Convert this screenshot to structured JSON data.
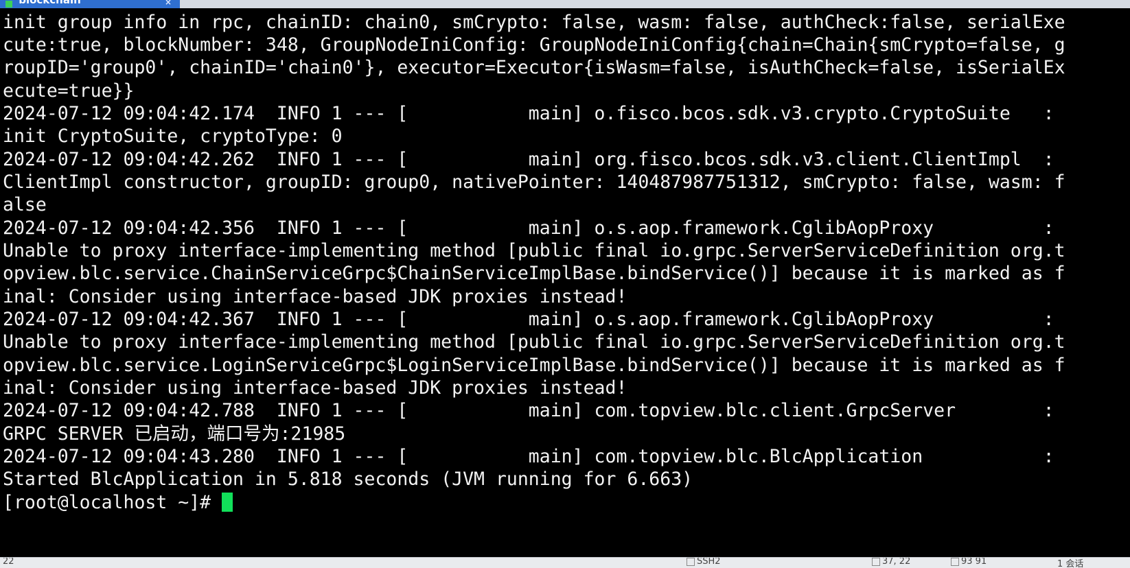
{
  "window": {
    "tab_title": "blockchain",
    "tab_close": "×"
  },
  "terminal": {
    "lines": [
      "init group info in rpc, chainID: chain0, smCrypto: false, wasm: false, authCheck:false, serialExe",
      "cute:true, blockNumber: 348, GroupNodeIniConfig: GroupNodeIniConfig{chain=Chain{smCrypto=false, g",
      "roupID='group0', chainID='chain0'}, executor=Executor{isWasm=false, isAuthCheck=false, isSerialEx",
      "ecute=true}}",
      "2024-07-12 09:04:42.174  INFO 1 --- [           main] o.fisco.bcos.sdk.v3.crypto.CryptoSuite   :",
      "init CryptoSuite, cryptoType: 0",
      "2024-07-12 09:04:42.262  INFO 1 --- [           main] org.fisco.bcos.sdk.v3.client.ClientImpl  :",
      "ClientImpl constructor, groupID: group0, nativePointer: 140487987751312, smCrypto: false, wasm: f",
      "alse",
      "2024-07-12 09:04:42.356  INFO 1 --- [           main] o.s.aop.framework.CglibAopProxy          :",
      "Unable to proxy interface-implementing method [public final io.grpc.ServerServiceDefinition org.t",
      "opview.blc.service.ChainServiceGrpc$ChainServiceImplBase.bindService()] because it is marked as f",
      "inal: Consider using interface-based JDK proxies instead!",
      "2024-07-12 09:04:42.367  INFO 1 --- [           main] o.s.aop.framework.CglibAopProxy          :",
      "Unable to proxy interface-implementing method [public final io.grpc.ServerServiceDefinition org.t",
      "opview.blc.service.LoginServiceGrpc$LoginServiceImplBase.bindService()] because it is marked as f",
      "inal: Consider using interface-based JDK proxies instead!",
      "2024-07-12 09:04:42.788  INFO 1 --- [           main] com.topview.blc.client.GrpcServer        :",
      "GRPC SERVER 已启动，端口号为:21985",
      "2024-07-12 09:04:43.280  INFO 1 --- [           main] com.topview.blc.BlcApplication           :",
      "Started BlcApplication in 5.818 seconds (JVM running for 6.663)"
    ],
    "prompt": "[root@localhost ~]# "
  },
  "statusbar": {
    "left": "22",
    "protocol": "SSH2",
    "position": "37, 22",
    "size": "93 91",
    "sessions": "1 会话"
  },
  "colors": {
    "background": "#000000",
    "text": "#f2f2f2",
    "cursor": "#11e05a",
    "tab_active": "#2f6fd0"
  }
}
